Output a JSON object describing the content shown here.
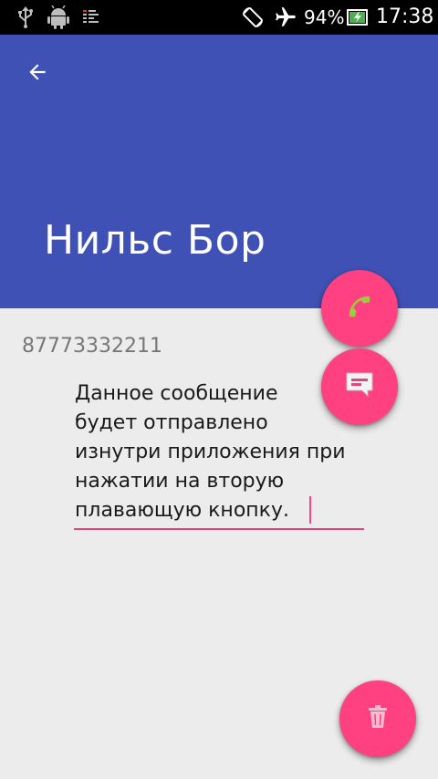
{
  "status_bar": {
    "battery_percent": "94%",
    "time": "17:38",
    "icons": [
      "usb-icon",
      "android-debug-icon",
      "sim-icon",
      "screen-rotation-icon",
      "airplane-mode-icon",
      "battery-charging-icon"
    ]
  },
  "app_bar": {
    "back_icon": "arrow-back-icon",
    "title": "Нильс Бор",
    "color": "#3f51b5"
  },
  "contact": {
    "phone": "87773332211"
  },
  "message": {
    "text": "Данное сообщение\nбудет отправлено\nизнутри приложения при\nнажатии на вторую\nплавающую кнопку."
  },
  "fabs": {
    "call_icon": "phone-icon",
    "message_icon": "message-icon",
    "delete_icon": "trash-icon",
    "color": "#ff4081"
  }
}
